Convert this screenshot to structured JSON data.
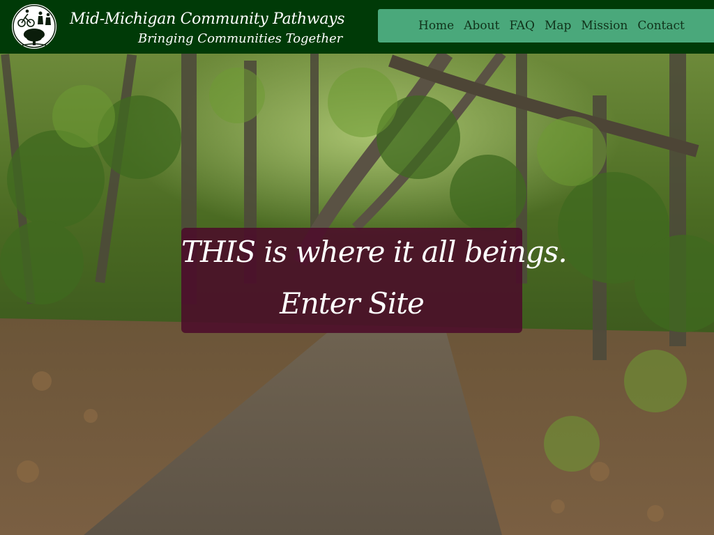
{
  "header": {
    "title": "Mid-Michigan Community Pathways",
    "tagline": "Bringing Communities Together",
    "logo_icon": "pathways-logo-icon"
  },
  "nav": {
    "items": [
      {
        "label": "Home"
      },
      {
        "label": "About"
      },
      {
        "label": "FAQ"
      },
      {
        "label": "Map"
      },
      {
        "label": "Mission"
      },
      {
        "label": "Contact"
      }
    ]
  },
  "hero": {
    "welcome_text": "THIS is where it all beings.",
    "enter_label": "Enter Site"
  },
  "colors": {
    "header_bg": "#003a07",
    "nav_bg": "#4aa87b",
    "welcome_box_bg": "#4c0a2a",
    "text_light": "#ffffff"
  }
}
